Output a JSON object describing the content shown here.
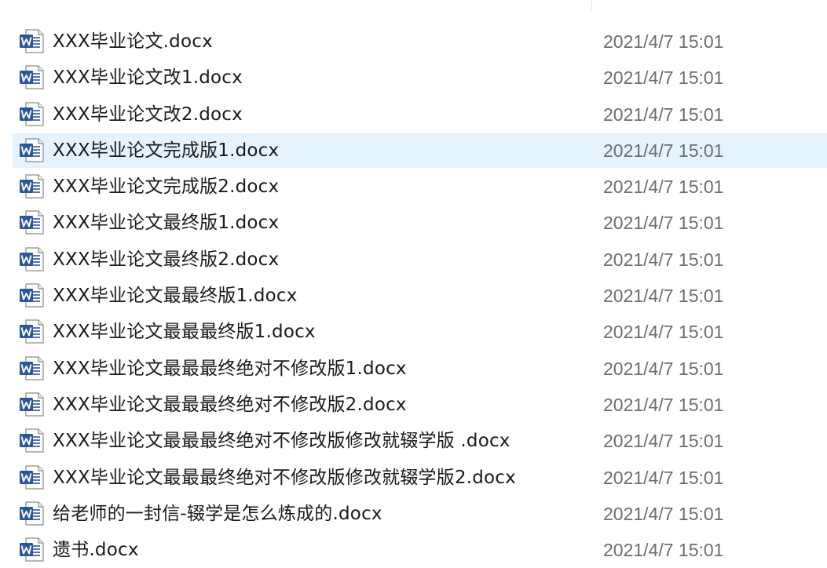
{
  "colors": {
    "selected_row_bg": "#e5f3ff",
    "name_text": "#1a1a1a",
    "date_text": "#6d6d6d",
    "word_icon_blue": "#2b579a"
  },
  "files": [
    {
      "name": "XXX毕业论文.docx",
      "modified": "2021/4/7 15:01",
      "icon": "word-document-icon",
      "selected": false
    },
    {
      "name": "XXX毕业论文改1.docx",
      "modified": "2021/4/7 15:01",
      "icon": "word-document-icon",
      "selected": false
    },
    {
      "name": "XXX毕业论文改2.docx",
      "modified": "2021/4/7 15:01",
      "icon": "word-document-icon",
      "selected": false
    },
    {
      "name": "XXX毕业论文完成版1.docx",
      "modified": "2021/4/7 15:01",
      "icon": "word-document-icon",
      "selected": true
    },
    {
      "name": "XXX毕业论文完成版2.docx",
      "modified": "2021/4/7 15:01",
      "icon": "word-document-icon",
      "selected": false
    },
    {
      "name": "XXX毕业论文最终版1.docx",
      "modified": "2021/4/7 15:01",
      "icon": "word-document-icon",
      "selected": false
    },
    {
      "name": "XXX毕业论文最终版2.docx",
      "modified": "2021/4/7 15:01",
      "icon": "word-document-icon",
      "selected": false
    },
    {
      "name": "XXX毕业论文最最终版1.docx",
      "modified": "2021/4/7 15:01",
      "icon": "word-document-icon",
      "selected": false
    },
    {
      "name": "XXX毕业论文最最最终版1.docx",
      "modified": "2021/4/7 15:01",
      "icon": "word-document-icon",
      "selected": false
    },
    {
      "name": "XXX毕业论文最最最终绝对不修改版1.docx",
      "modified": "2021/4/7 15:01",
      "icon": "word-document-icon",
      "selected": false
    },
    {
      "name": "XXX毕业论文最最最终绝对不修改版2.docx",
      "modified": "2021/4/7 15:01",
      "icon": "word-document-icon",
      "selected": false
    },
    {
      "name": "XXX毕业论文最最最终绝对不修改版修改就辍学版 .docx",
      "modified": "2021/4/7 15:01",
      "icon": "word-document-icon",
      "selected": false
    },
    {
      "name": "XXX毕业论文最最最终绝对不修改版修改就辍学版2.docx",
      "modified": "2021/4/7 15:01",
      "icon": "word-document-icon",
      "selected": false
    },
    {
      "name": "给老师的一封信-辍学是怎么炼成的.docx",
      "modified": "2021/4/7 15:01",
      "icon": "word-document-icon",
      "selected": false
    },
    {
      "name": "遗书.docx",
      "modified": "2021/4/7 15:01",
      "icon": "word-document-icon",
      "selected": false
    }
  ]
}
